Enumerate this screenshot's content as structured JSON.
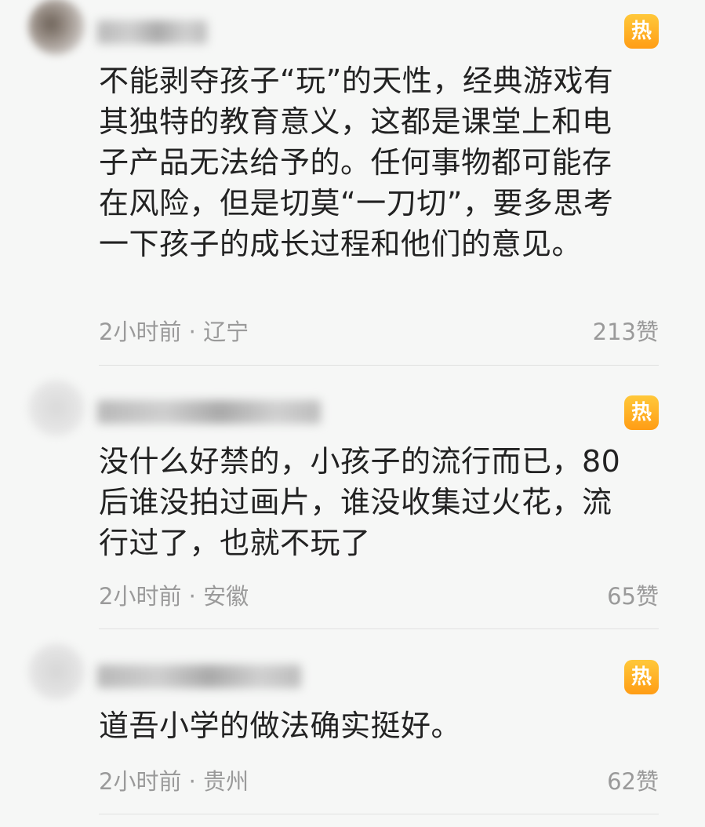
{
  "comments": [
    {
      "hot_badge": "热",
      "text": "不能剥夺孩子“玩”的天性，经典游戏有其独特的教育意义，这都是课堂上和电子产品无法给予的。任何事物都可能存在风险，但是切莫“一刀切”，要多思考一下孩子的成长过程和他们的意见。",
      "meta": "2小时前 · 辽宁",
      "likes": "213赞"
    },
    {
      "hot_badge": "热",
      "text": "没什么好禁的，小孩子的流行而已，80后谁没拍过画片，谁没收集过火花，流行过了，也就不玩了",
      "meta": "2小时前 · 安徽",
      "likes": "65赞"
    },
    {
      "hot_badge": "热",
      "text": "道吾小学的做法确实挺好。",
      "meta": "2小时前 · 贵州",
      "likes": "62赞"
    }
  ]
}
